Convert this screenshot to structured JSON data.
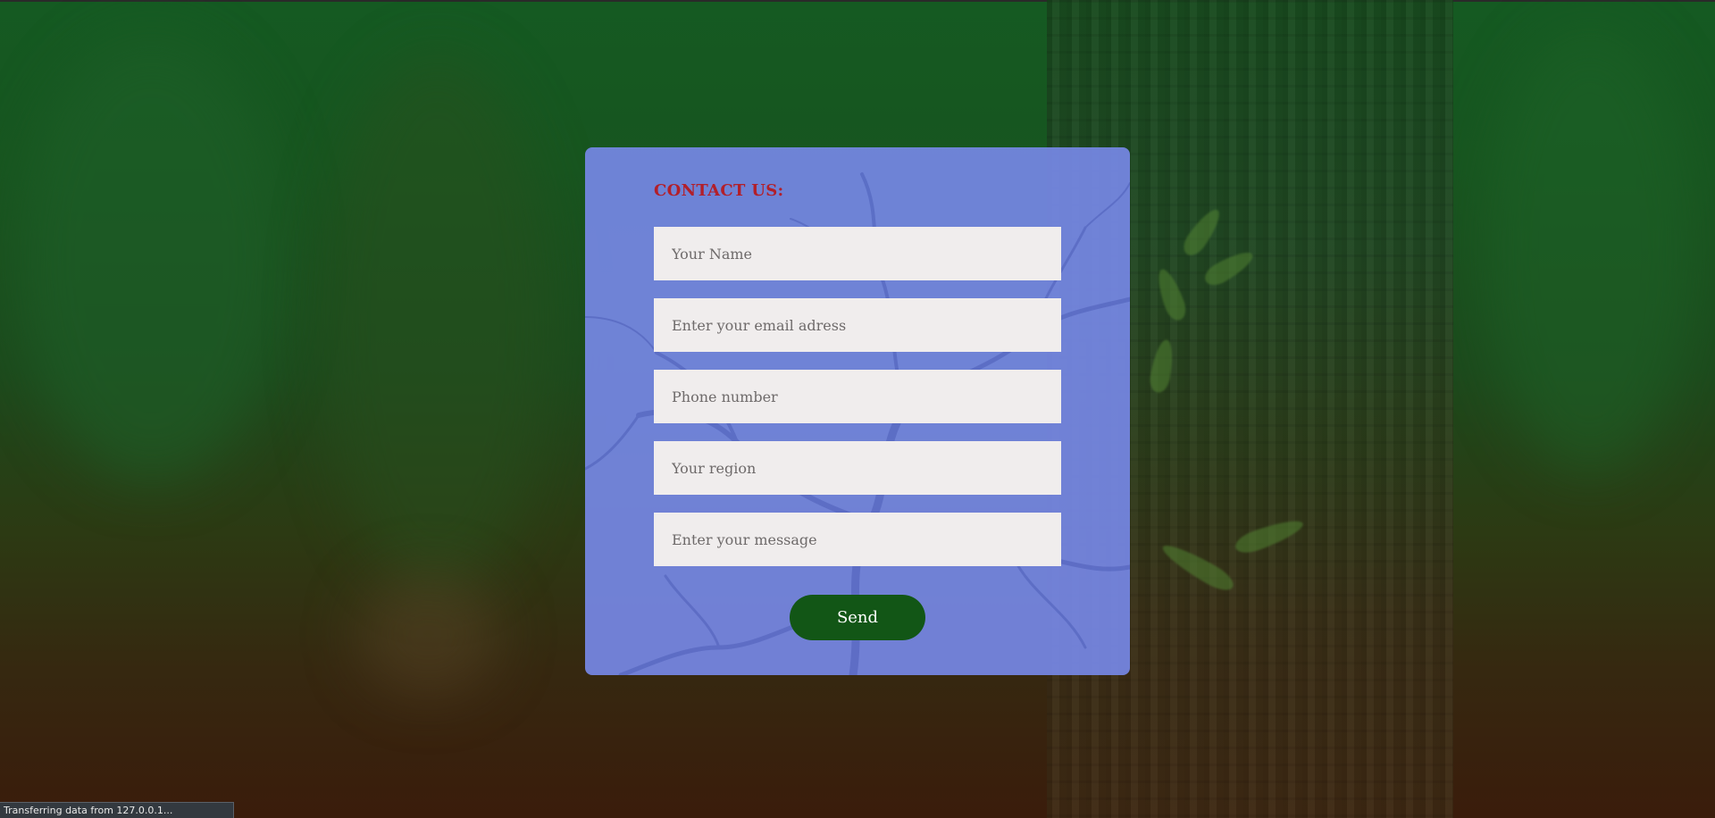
{
  "form": {
    "title": "CONTACT US:",
    "fields": [
      {
        "placeholder": "Your Name",
        "value": ""
      },
      {
        "placeholder": "Enter your email adress",
        "value": ""
      },
      {
        "placeholder": "Phone number",
        "value": ""
      },
      {
        "placeholder": "Your region",
        "value": ""
      },
      {
        "placeholder": "Enter your message",
        "value": ""
      }
    ],
    "send_label": "Send"
  },
  "status_bar": {
    "text": "Transferring data from 127.0.0.1..."
  },
  "colors": {
    "card_background": "#7688e6",
    "title": "#b21f2a",
    "send_button": "#125616",
    "field_background": "#f0eded"
  }
}
